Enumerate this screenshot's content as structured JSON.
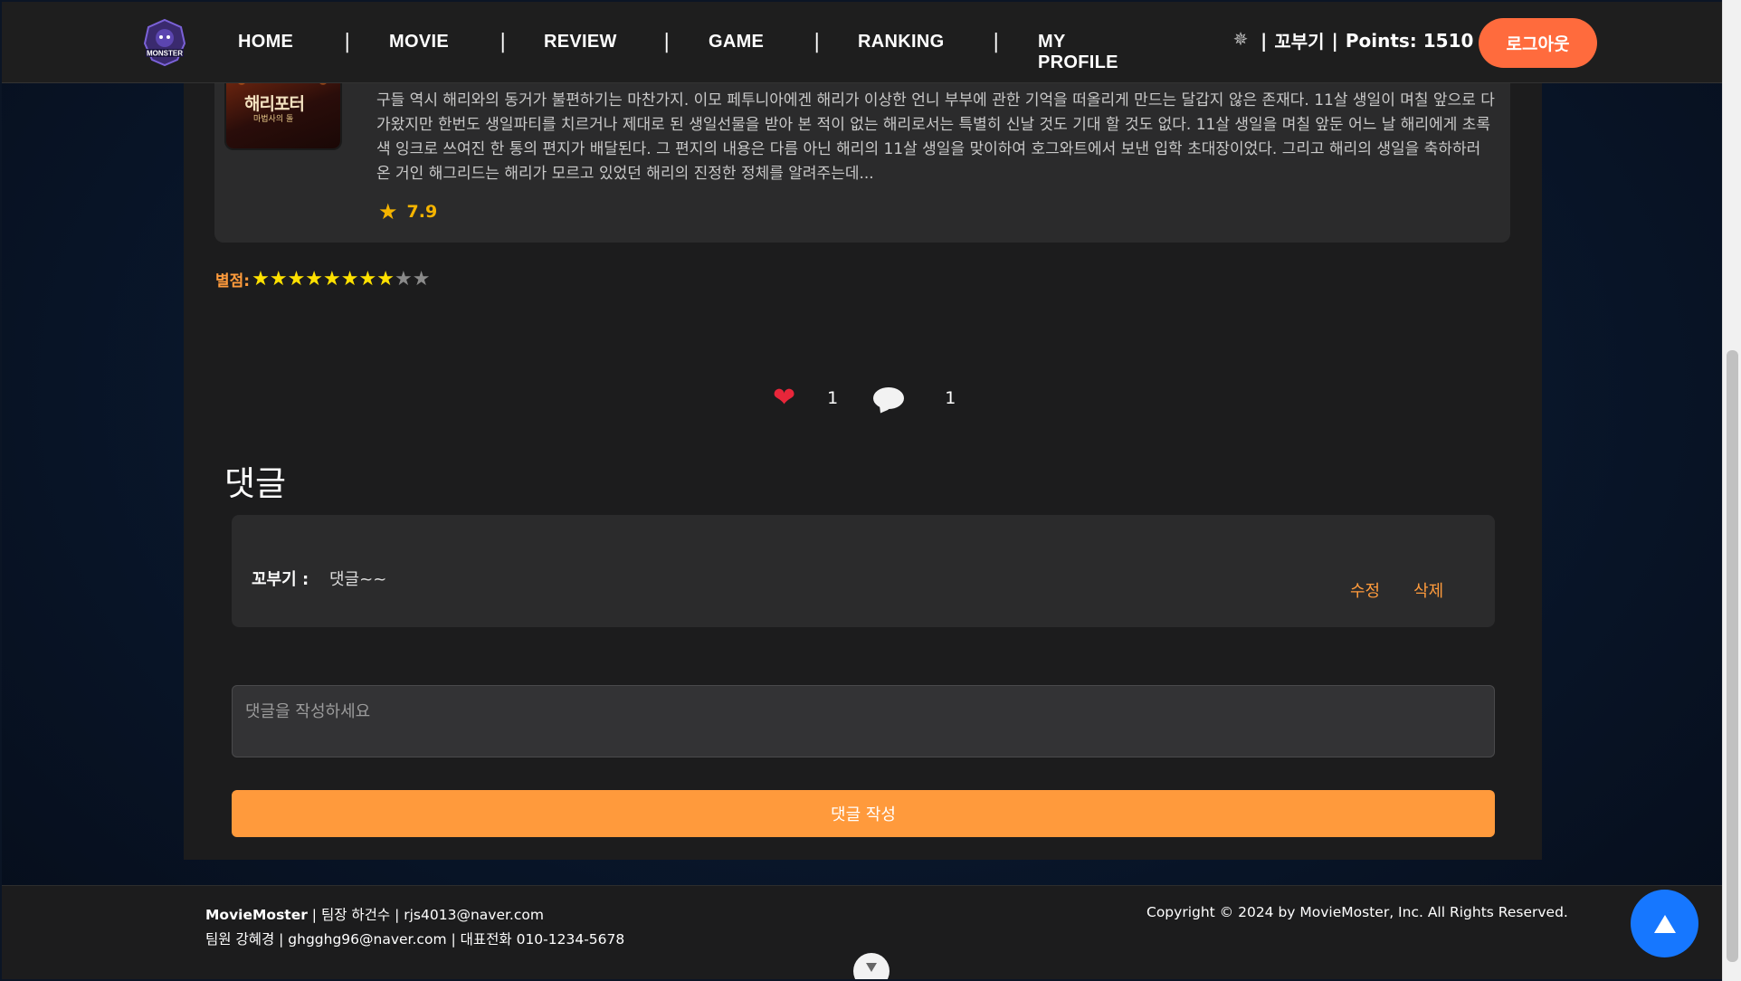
{
  "header": {
    "nav": [
      {
        "label": "HOME"
      },
      {
        "label": "MOVIE"
      },
      {
        "label": "REVIEW"
      },
      {
        "label": "GAME"
      },
      {
        "label": "RANKING"
      },
      {
        "label": "MY PROFILE"
      }
    ],
    "separator": "|",
    "user_name": "꼬부기",
    "points_label": "Points: 1510",
    "logout_label": "로그아웃"
  },
  "movie": {
    "poster_title": "해리포터",
    "poster_subtitle": "마법사의 돌",
    "overview": "구들 역시 해리와의 동거가 불편하기는 마찬가지. 이모 페투니아에겐 해리가 이상한 언니 부부에 관한 기억을 떠올리게 만드는 달갑지 않은 존재다. 11살 생일이 며칠 앞으로 다가왔지만 한번도 생일파티를 치르거나 제대로 된 생일선물을 받아 본 적이 없는 해리로서는 특별히 신날 것도 기대 할 것도 없다. 11살 생일을 며칠 앞둔 어느 날 해리에게 초록색 잉크로 쓰여진 한 통의 편지가 배달된다. 그 편지의 내용은 다름 아닌 해리의 11살 생일을 맞이하여 호그와트에서 보낸 입학 초대장이었다. 그리고 해리의 생일을 축하하러 온 거인 해그리드는 해리가 모르고 있었던 해리의 진정한 정체를 알려주는데...",
    "rating": "7.9"
  },
  "review": {
    "stars_label": "별점:",
    "stars_filled": 8,
    "stars_total": 10,
    "likes": "1",
    "comments_count": "1"
  },
  "comments": {
    "title": "댓글",
    "items": [
      {
        "author": "꼬부기 :",
        "text": "댓글~~",
        "edit": "수정",
        "delete": "삭제"
      }
    ],
    "input_placeholder": "댓글을 작성하세요",
    "submit_label": "댓글 작성"
  },
  "footer": {
    "brand": "MovieMoster",
    "line1_rest": " | 팀장 하건수 | rjs4013@naver.com",
    "line2": "팀원 강혜경 | ghgghg96@naver.com | 대표전화 010-1234-5678",
    "copyright": "Copyright © 2024 by MovieMoster, Inc. All Rights Reserved."
  },
  "colors": {
    "accent": "#ff9a3c",
    "logout": "#ff6b3d",
    "scroll_top": "#1677ff",
    "star": "#ffe100"
  }
}
